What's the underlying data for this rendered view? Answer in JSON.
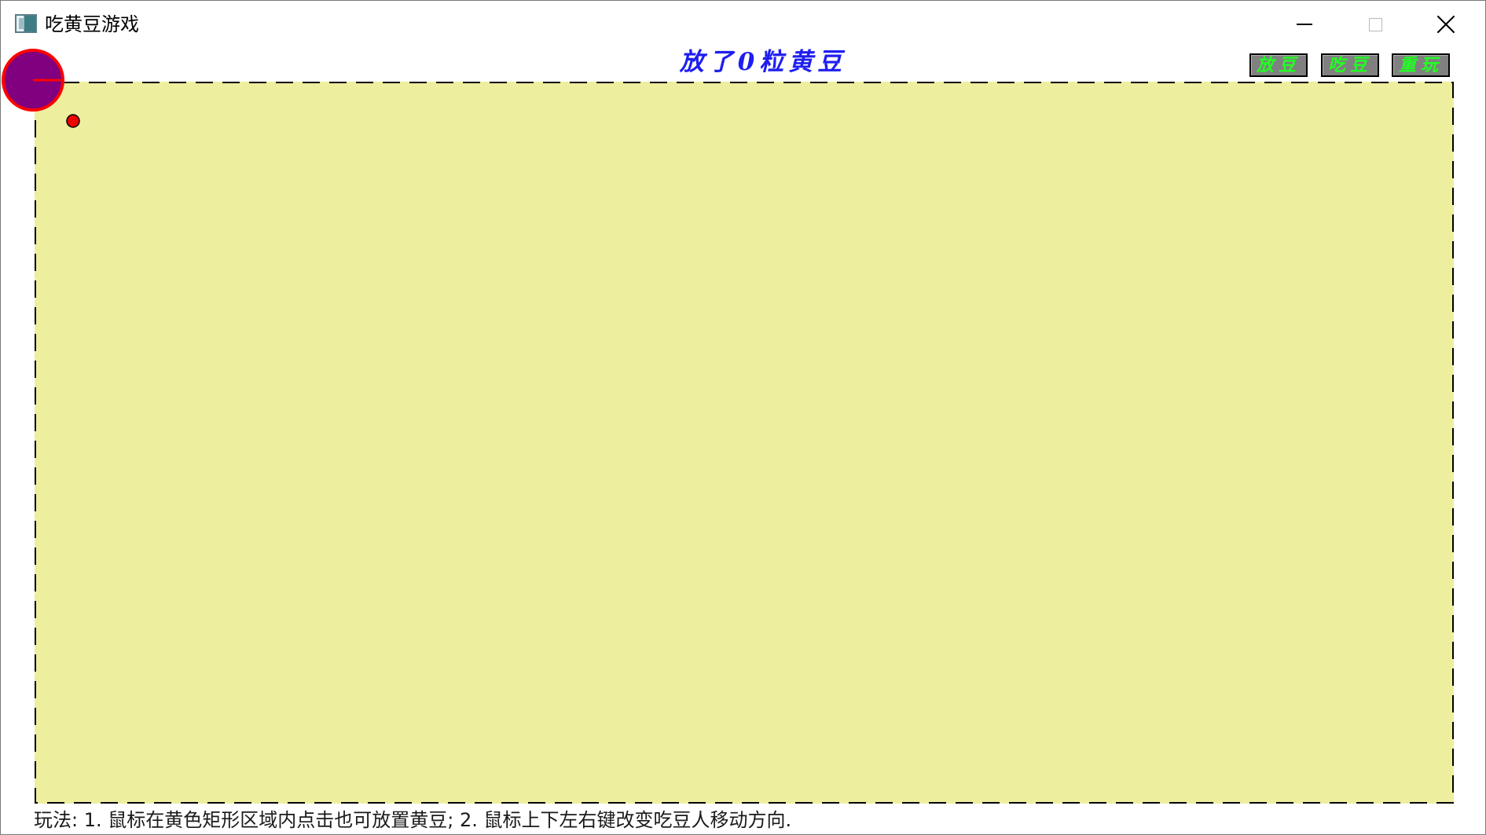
{
  "window": {
    "title": "吃黄豆游戏",
    "icon": "app-window-icon",
    "controls": {
      "minimize": "minimize-icon",
      "maximize": "maximize-icon",
      "close": "close-icon"
    }
  },
  "game": {
    "counter_text": "放了0粒黄豆",
    "beans_placed": 0,
    "buttons": {
      "place": "放豆",
      "eat": "吃豆",
      "replay": "重玩"
    },
    "instructions": "玩法: 1. 鼠标在黄色矩形区域内点击也可放置黄豆; 2. 鼠标上下左右键改变吃豆人移动方向.",
    "colors": {
      "play_area": "#eeee9f",
      "counter_text": "#1e1ef0",
      "button_text": "#22ff22",
      "button_bg": "#808080",
      "pacman_body": "#800080",
      "pacman_outline": "#ff0000",
      "bean": "#ee0000"
    },
    "pacman_direction": "right"
  }
}
